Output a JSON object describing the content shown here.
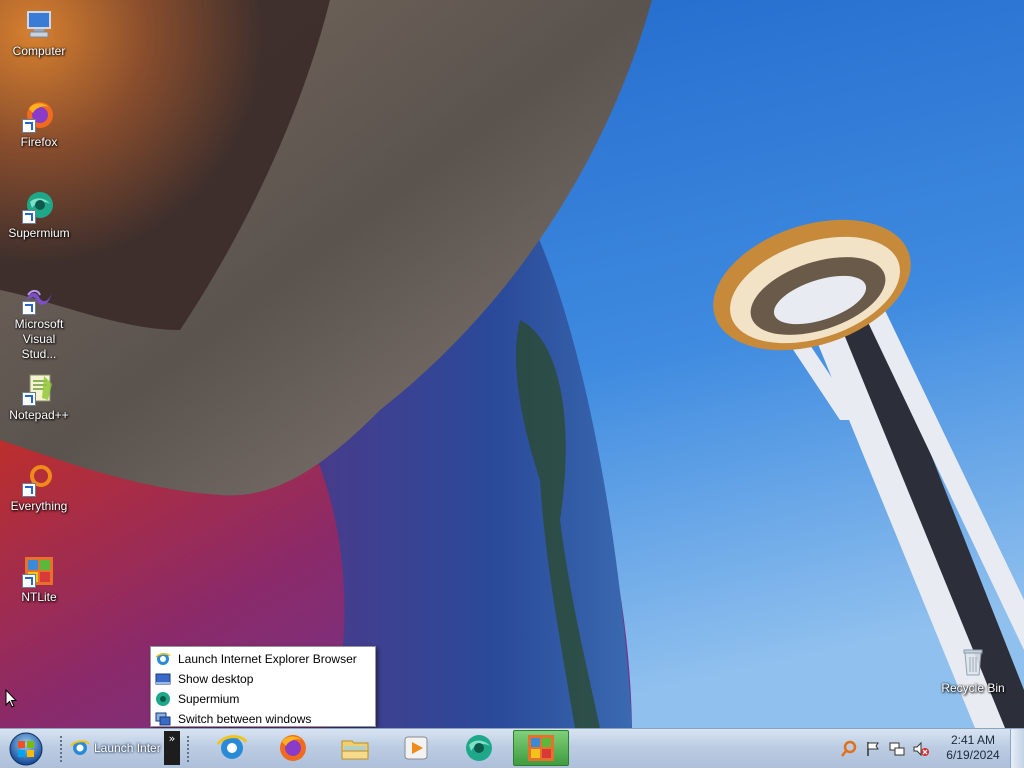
{
  "desktop": {
    "icons": [
      {
        "label": "Computer",
        "icon": "computer-icon"
      },
      {
        "label": "Firefox",
        "icon": "firefox-icon"
      },
      {
        "label": "Supermium",
        "icon": "supermium-icon"
      },
      {
        "label": "Microsoft Visual Stud...",
        "icon": "visual-studio-icon"
      },
      {
        "label": "Notepad++",
        "icon": "notepadpp-icon"
      },
      {
        "label": "Everything",
        "icon": "everything-icon"
      },
      {
        "label": "NTLite",
        "icon": "ntlite-icon"
      },
      {
        "label": "Recycle Bin",
        "icon": "recycle-bin-icon"
      }
    ]
  },
  "context_menu": {
    "items": [
      {
        "label": "Launch Internet Explorer Browser",
        "icon": "internet-explorer-icon"
      },
      {
        "label": "Show desktop",
        "icon": "show-desktop-icon"
      },
      {
        "label": "Supermium",
        "icon": "supermium-icon"
      },
      {
        "label": "Switch between windows",
        "icon": "switch-windows-icon"
      }
    ]
  },
  "taskbar": {
    "quick_launch_label": "Launch Inter",
    "overflow_glyph": "»",
    "pinned": [
      "internet-explorer-icon",
      "firefox-icon",
      "file-explorer-icon",
      "media-player-icon",
      "supermium-icon",
      "ntlite-icon"
    ],
    "active_app": "ntlite-icon",
    "tray_icons": [
      "search-icon",
      "action-center-flag-icon",
      "network-icon",
      "volume-muted-icon"
    ],
    "clock": {
      "time": "2:41 AM",
      "date": "6/19/2024"
    }
  },
  "colors": {
    "taskbar": "#bccde3",
    "sky": "#2f7ad6",
    "active_task": "#4fae4a"
  }
}
